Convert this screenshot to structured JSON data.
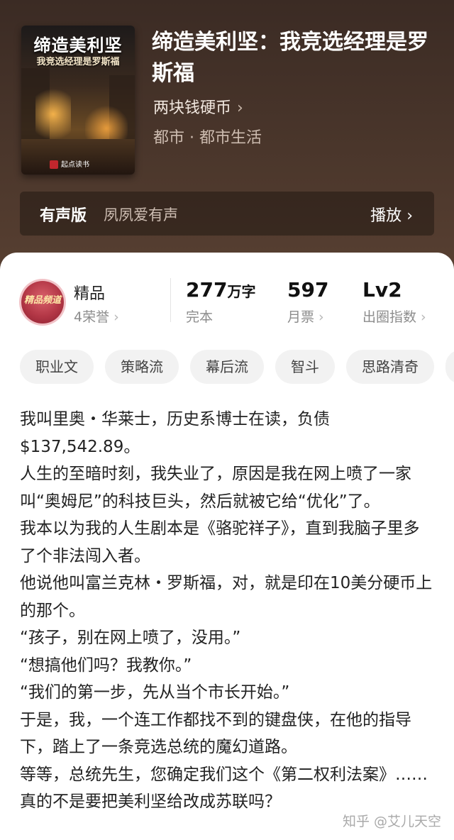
{
  "book": {
    "cover": {
      "title": "缔造美利坚",
      "subtitle": "我竞选经理是罗斯福",
      "publisher": "起点读书"
    },
    "title": "缔造美利坚：我竞选经理是罗斯福",
    "author": "两块钱硬币",
    "genre": "都市 · 都市生活"
  },
  "audio": {
    "label": "有声版",
    "narrator": "夙夙爱有声",
    "play": "播放"
  },
  "stats": {
    "badge_text": "精品频道",
    "quality": "精品",
    "honor": "4荣誉",
    "words_num": "277",
    "words_unit": "万字",
    "words_status": "完本",
    "votes": "597",
    "votes_label": "月票",
    "level": "Lv2",
    "level_label": "出圈指数"
  },
  "tags": [
    "职业文",
    "策略流",
    "幕后流",
    "智斗",
    "思路清奇",
    ""
  ],
  "intro": [
    "我叫里奥・华莱士，历史系博士在读，负债$137,542.89。",
    "人生的至暗时刻，我失业了，原因是我在网上喷了一家叫“奥姆尼”的科技巨头，然后就被它给“优化”了。",
    "我本以为我的人生剧本是《骆驼祥子》，直到我脑子里多了个非法闯入者。",
    "他说他叫富兰克林・罗斯福，对，就是印在10美分硬币上的那个。",
    "“孩子，别在网上喷了，没用。”",
    "“想搞他们吗？我教你。”",
    "“我们的第一步，先从当个市长开始。”",
    "于是，我，一个连工作都找不到的键盘侠，在他的指导下，踏上了一条竞选总统的魔幻道路。",
    "等等，总统先生，您确定我们这个《第二权利法案》……真的不是要把美利坚给改成苏联吗？"
  ],
  "watermark": "知乎 @艾儿天空",
  "icons": {
    "chevron": "chevron-right-icon"
  }
}
